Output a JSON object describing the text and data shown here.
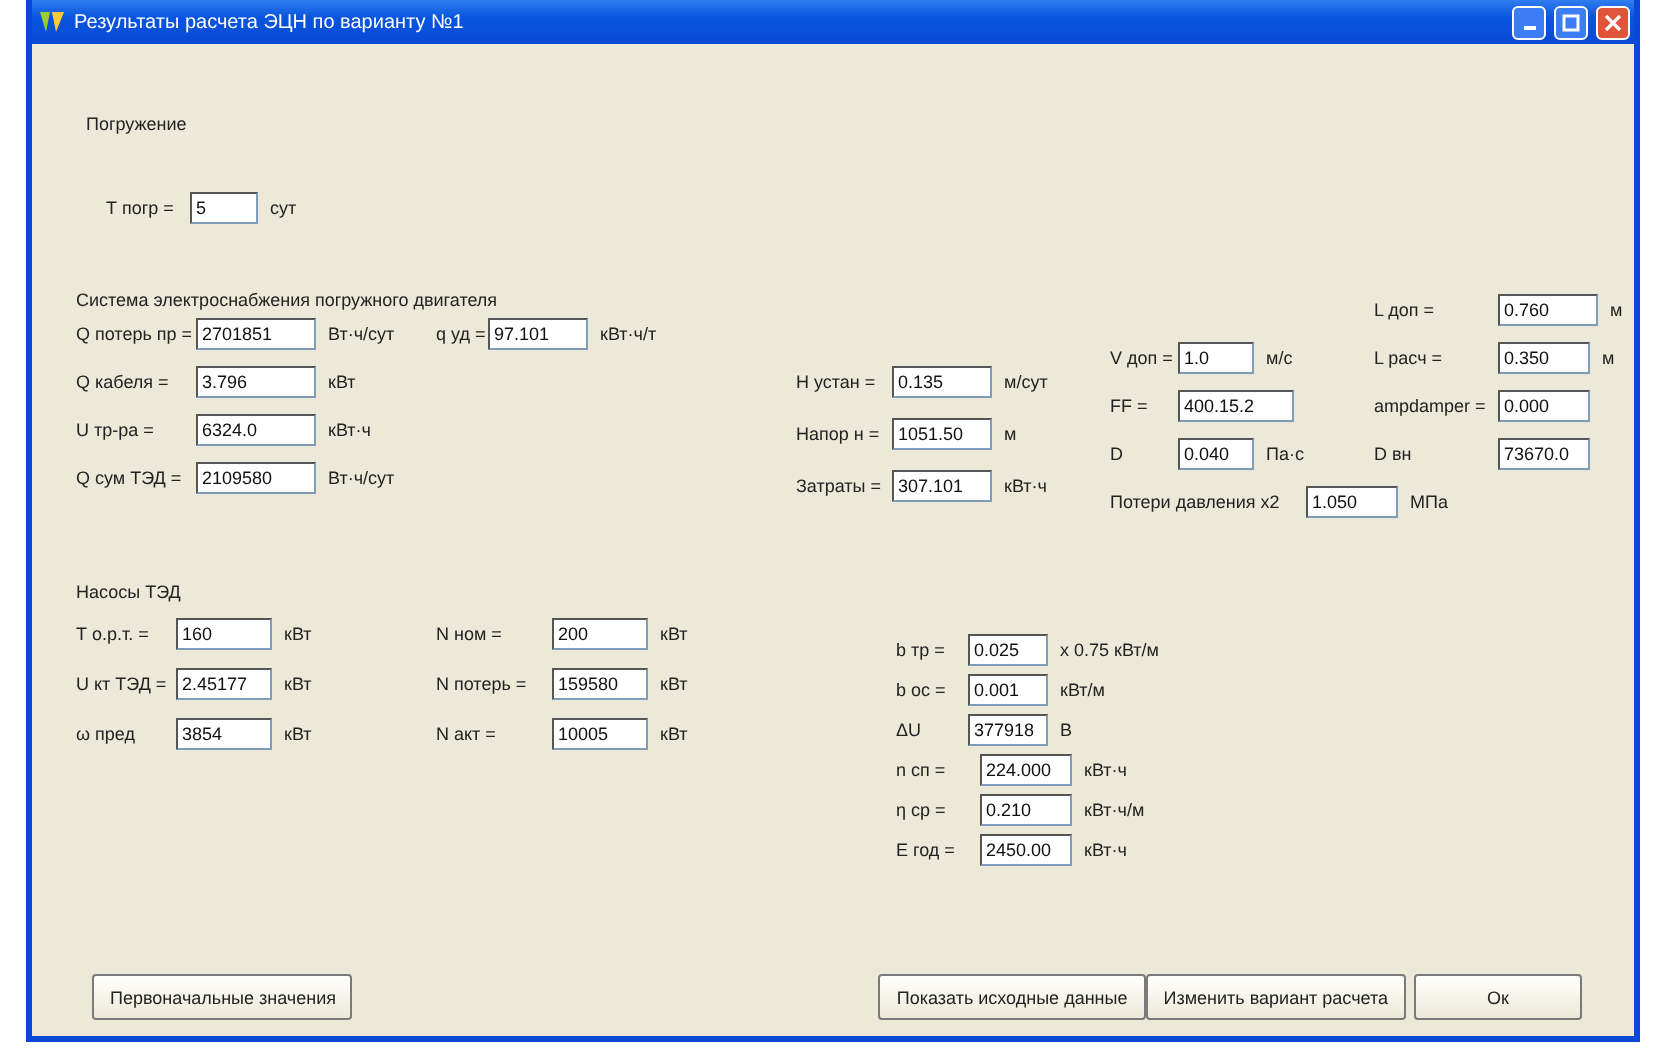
{
  "window": {
    "title": "Результаты расчета ЭЦН по варианту №1"
  },
  "immersion": {
    "heading": "Погружение",
    "fields": [
      {
        "label": "Т погр =",
        "value": "5",
        "unit": "сут"
      }
    ]
  },
  "power": {
    "heading": "Система электроснабжения погружного двигателя",
    "left_rows": [
      {
        "fields": [
          {
            "label": "Q потерь пр =",
            "value": "2701851",
            "unit": "Вт·ч/сут"
          },
          {
            "label": "q уд =",
            "value": "97.101",
            "unit": "кВт·ч/т"
          }
        ]
      },
      {
        "fields": [
          {
            "label": "Q кабеля =",
            "value": "3.796",
            "unit": "кВт"
          }
        ]
      },
      {
        "fields": [
          {
            "label": "U тр-ра =",
            "value": "6324.0",
            "unit": "кВт·ч"
          }
        ]
      },
      {
        "fields": [
          {
            "label": "Q сум ТЭД =",
            "value": "2109580",
            "unit": "Вт·ч/сут"
          }
        ]
      }
    ],
    "middle": [
      {
        "label": "Н устан =",
        "value": "0.135",
        "unit": "м/сут"
      },
      {
        "label": "Напор н =",
        "value": "1051.50",
        "unit": "м"
      },
      {
        "label": "Затраты =",
        "value": "307.101",
        "unit": "кВт·ч"
      }
    ],
    "right_rows": [
      {
        "right": {
          "label": "L доп =",
          "value": "0.760",
          "unit": "м"
        }
      },
      {
        "left": {
          "label": "V доп =",
          "value": "1.0",
          "unit": "м/с"
        },
        "right": {
          "label": "L расч =",
          "value": "0.350",
          "unit": "м"
        }
      },
      {
        "left": {
          "label": "FF =",
          "value": "400.15.2"
        },
        "right": {
          "label": "ampdamper =",
          "value": "0.000"
        }
      },
      {
        "left": {
          "label": "D",
          "value": "0.040",
          "unit": "Па·с"
        },
        "right": {
          "label": "D вн",
          "value": "73670.0"
        }
      },
      {
        "left": {
          "label": "Потери давления х2",
          "value": "1.050",
          "unit": "МПа"
        }
      }
    ]
  },
  "motor": {
    "heading": "Насосы ТЭД",
    "left": [
      {
        "label": "Т о.р.т. =",
        "value": "160",
        "unit": "кВт"
      },
      {
        "label": "U кт ТЭД =",
        "value": "2.45177",
        "unit": "кВт"
      },
      {
        "label": "ω пред",
        "value": "3854",
        "unit": "кВт"
      }
    ],
    "middle": [
      {
        "label": "N ном =",
        "value": "200",
        "unit": "кВт"
      },
      {
        "label": "N потерь =",
        "value": "159580",
        "unit": "кВт"
      },
      {
        "label": "N акт =",
        "value": "10005",
        "unit": "кВт"
      }
    ],
    "right": [
      {
        "label": "b тр =",
        "value": "0.025",
        "unit": "х 0.75 кВт/м"
      },
      {
        "label": "b ос =",
        "value": "0.001",
        "unit": "кВт/м"
      },
      {
        "label": "ΔU",
        "value": "377918",
        "unit": "В"
      },
      {
        "label": "n сп =",
        "value": "224.000",
        "unit": "кВт·ч"
      },
      {
        "label": "η ср =",
        "value": "0.210",
        "unit": "кВт·ч/м"
      },
      {
        "label": "Е год =",
        "value": "2450.00",
        "unit": "кВт·ч"
      }
    ]
  },
  "buttons_left": [
    "Первоначальные значения"
  ],
  "buttons_right": [
    "Показать исходные данные",
    "Изменить вариант расчета",
    "Ок"
  ]
}
